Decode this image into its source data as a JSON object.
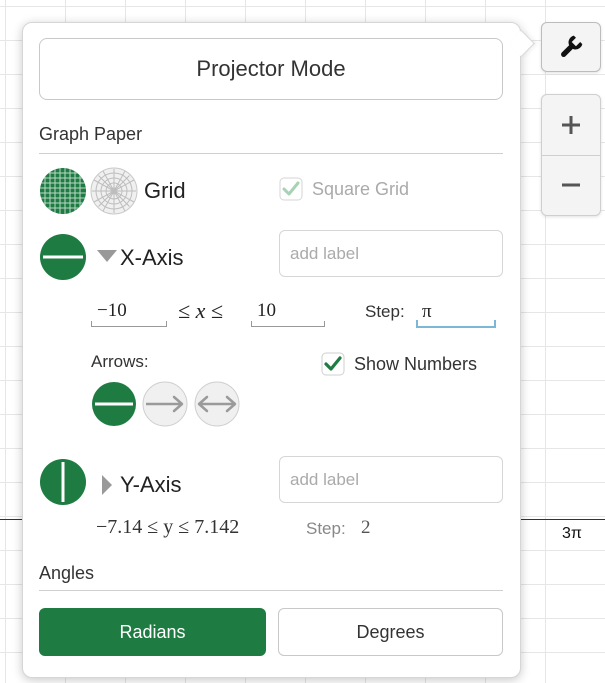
{
  "graph": {
    "x_tick_label": "3π"
  },
  "panel": {
    "projector_mode_label": "Projector Mode",
    "graph_paper": {
      "title": "Graph Paper",
      "grid_label": "Grid",
      "square_grid_label": "Square Grid",
      "square_grid_checked": true
    },
    "x_axis": {
      "label": "X-Axis",
      "label_placeholder": "add label",
      "min": "−10",
      "max": "10",
      "inequality": "≤ x ≤",
      "step_label": "Step:",
      "step_value": "π",
      "arrows_label": "Arrows:",
      "show_numbers_label": "Show Numbers",
      "show_numbers_checked": true
    },
    "y_axis": {
      "label": "Y-Axis",
      "label_placeholder": "add label",
      "range_text": "−7.14 ≤ y ≤ 7.142",
      "step_label": "Step:",
      "step_value": "2"
    },
    "angles": {
      "title": "Angles",
      "radians_label": "Radians",
      "degrees_label": "Degrees",
      "selected": "Radians"
    }
  },
  "colors": {
    "accent": "#1e7b42",
    "checkbox_inactive": "#a8d2b4"
  },
  "icons": [
    "wrench-icon",
    "plus-icon",
    "minus-icon",
    "grid-icon",
    "polar-grid-icon",
    "x-axis-icon",
    "y-axis-icon",
    "arrow-none-icon",
    "arrow-right-icon",
    "arrow-both-icon"
  ]
}
